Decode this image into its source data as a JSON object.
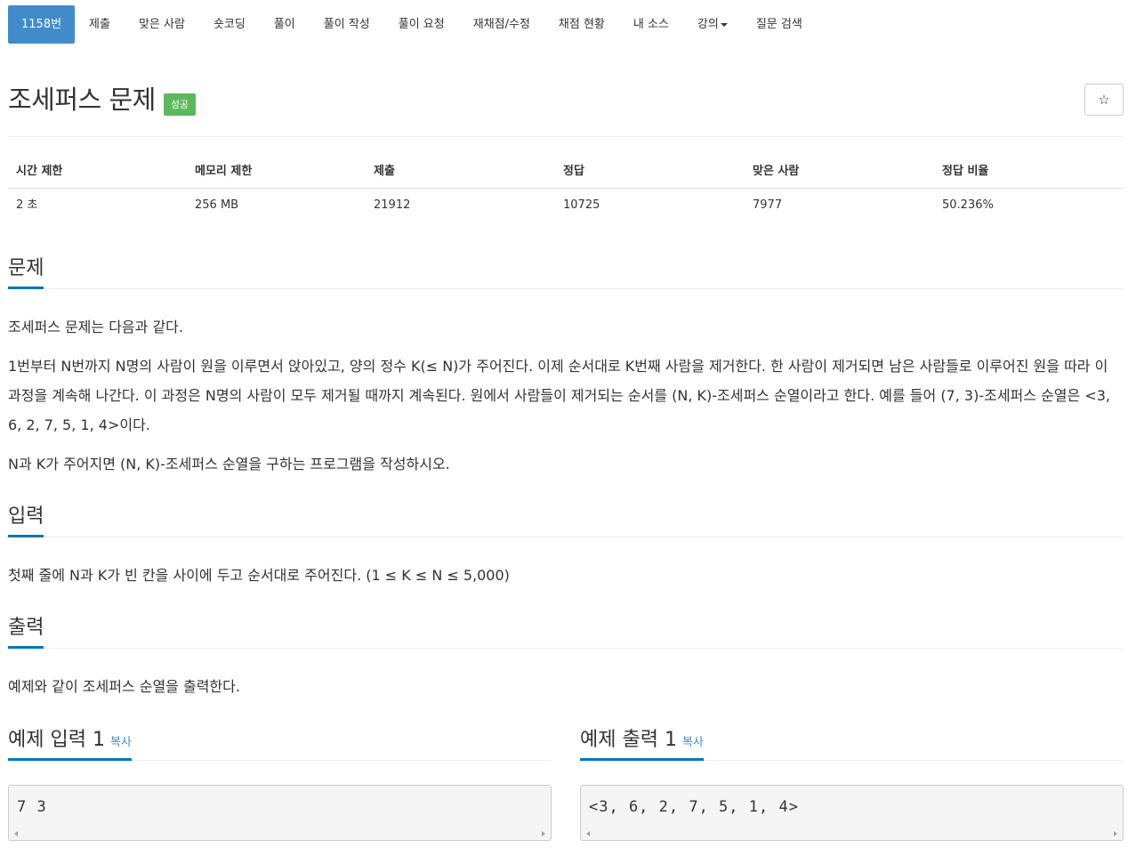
{
  "nav": {
    "items": [
      {
        "label": "1158번",
        "active": true
      },
      {
        "label": "제출"
      },
      {
        "label": "맞은 사람"
      },
      {
        "label": "숏코딩"
      },
      {
        "label": "풀이"
      },
      {
        "label": "풀이 작성"
      },
      {
        "label": "풀이 요청"
      },
      {
        "label": "재채점/수정"
      },
      {
        "label": "채점 현황"
      },
      {
        "label": "내 소스"
      },
      {
        "label": "강의"
      },
      {
        "label": "질문 검색"
      }
    ]
  },
  "problem": {
    "title": "조세퍼스 문제",
    "badge": "성공",
    "star_icon": "☆"
  },
  "stats": {
    "headers": [
      "시간 제한",
      "메모리 제한",
      "제출",
      "정답",
      "맞은 사람",
      "정답 비율"
    ],
    "values": [
      "2 초",
      "256 MB",
      "21912",
      "10725",
      "7977",
      "50.236%"
    ]
  },
  "sections": {
    "description": {
      "heading": "문제",
      "paragraphs": [
        "조세퍼스 문제는 다음과 같다.",
        "1번부터 N번까지 N명의 사람이 원을 이루면서 앉아있고, 양의 정수 K(≤ N)가 주어진다. 이제 순서대로 K번째 사람을 제거한다. 한 사람이 제거되면 남은 사람들로 이루어진 원을 따라 이 과정을 계속해 나간다. 이 과정은 N명의 사람이 모두 제거될 때까지 계속된다. 원에서 사람들이 제거되는 순서를 (N, K)-조세퍼스 순열이라고 한다. 예를 들어 (7, 3)-조세퍼스 순열은 <3, 6, 2, 7, 5, 1, 4>이다.",
        "N과 K가 주어지면 (N, K)-조세퍼스 순열을 구하는 프로그램을 작성하시오."
      ]
    },
    "input": {
      "heading": "입력",
      "text": "첫째 줄에 N과 K가 빈 칸을 사이에 두고 순서대로 주어진다. (1 ≤ K ≤ N ≤ 5,000)"
    },
    "output": {
      "heading": "출력",
      "text": "예제와 같이 조세퍼스 순열을 출력한다."
    },
    "sample_input": {
      "heading": "예제 입력 1",
      "copy": "복사",
      "content": "7 3"
    },
    "sample_output": {
      "heading": "예제 출력 1",
      "copy": "복사",
      "content": "<3, 6, 2, 7, 5, 1, 4>"
    }
  }
}
